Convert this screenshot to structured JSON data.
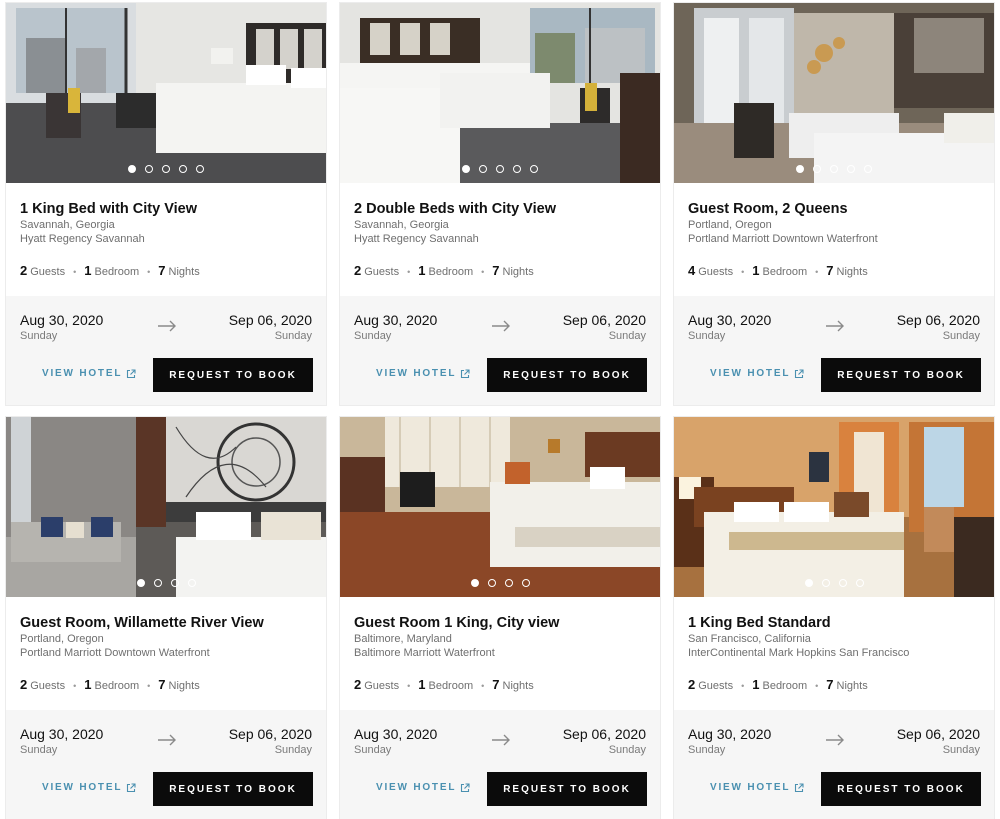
{
  "colors": {
    "link": "#4a90b0",
    "button_bg": "#0b0b0b",
    "panel_bg": "#f6f6f6"
  },
  "labels": {
    "guests": "Guests",
    "bedroom": "Bedroom",
    "nights": "Nights",
    "view_hotel": "VIEW HOTEL",
    "request": "REQUEST TO BOOK"
  },
  "cards": [
    {
      "title": "1 King Bed with City View",
      "location": "Savannah, Georgia",
      "hotel": "Hyatt Regency Savannah",
      "guests": "2",
      "bedrooms": "1",
      "nights": "7",
      "checkin": "Aug 30, 2020",
      "checkin_day": "Sunday",
      "checkout": "Sep 06, 2020",
      "checkout_day": "Sunday",
      "photo_count": 5,
      "active_photo": 0
    },
    {
      "title": "2 Double Beds with City View",
      "location": "Savannah, Georgia",
      "hotel": "Hyatt Regency Savannah",
      "guests": "2",
      "bedrooms": "1",
      "nights": "7",
      "checkin": "Aug 30, 2020",
      "checkin_day": "Sunday",
      "checkout": "Sep 06, 2020",
      "checkout_day": "Sunday",
      "photo_count": 5,
      "active_photo": 0
    },
    {
      "title": "Guest Room, 2 Queens",
      "location": "Portland, Oregon",
      "hotel": "Portland Marriott Downtown Waterfront",
      "guests": "4",
      "bedrooms": "1",
      "nights": "7",
      "checkin": "Aug 30, 2020",
      "checkin_day": "Sunday",
      "checkout": "Sep 06, 2020",
      "checkout_day": "Sunday",
      "photo_count": 5,
      "active_photo": 0
    },
    {
      "title": "Guest Room, Willamette River View",
      "location": "Portland, Oregon",
      "hotel": "Portland Marriott Downtown Waterfront",
      "guests": "2",
      "bedrooms": "1",
      "nights": "7",
      "checkin": "Aug 30, 2020",
      "checkin_day": "Sunday",
      "checkout": "Sep 06, 2020",
      "checkout_day": "Sunday",
      "photo_count": 4,
      "active_photo": 0
    },
    {
      "title": "Guest Room 1 King, City view",
      "location": "Baltimore, Maryland",
      "hotel": "Baltimore Marriott Waterfront",
      "guests": "2",
      "bedrooms": "1",
      "nights": "7",
      "checkin": "Aug 30, 2020",
      "checkin_day": "Sunday",
      "checkout": "Sep 06, 2020",
      "checkout_day": "Sunday",
      "photo_count": 4,
      "active_photo": 0
    },
    {
      "title": "1 King Bed Standard",
      "location": "San Francisco, California",
      "hotel": "InterContinental Mark Hopkins San Francisco",
      "guests": "2",
      "bedrooms": "1",
      "nights": "7",
      "checkin": "Aug 30, 2020",
      "checkin_day": "Sunday",
      "checkout": "Sep 06, 2020",
      "checkout_day": "Sunday",
      "photo_count": 4,
      "active_photo": 0
    }
  ]
}
